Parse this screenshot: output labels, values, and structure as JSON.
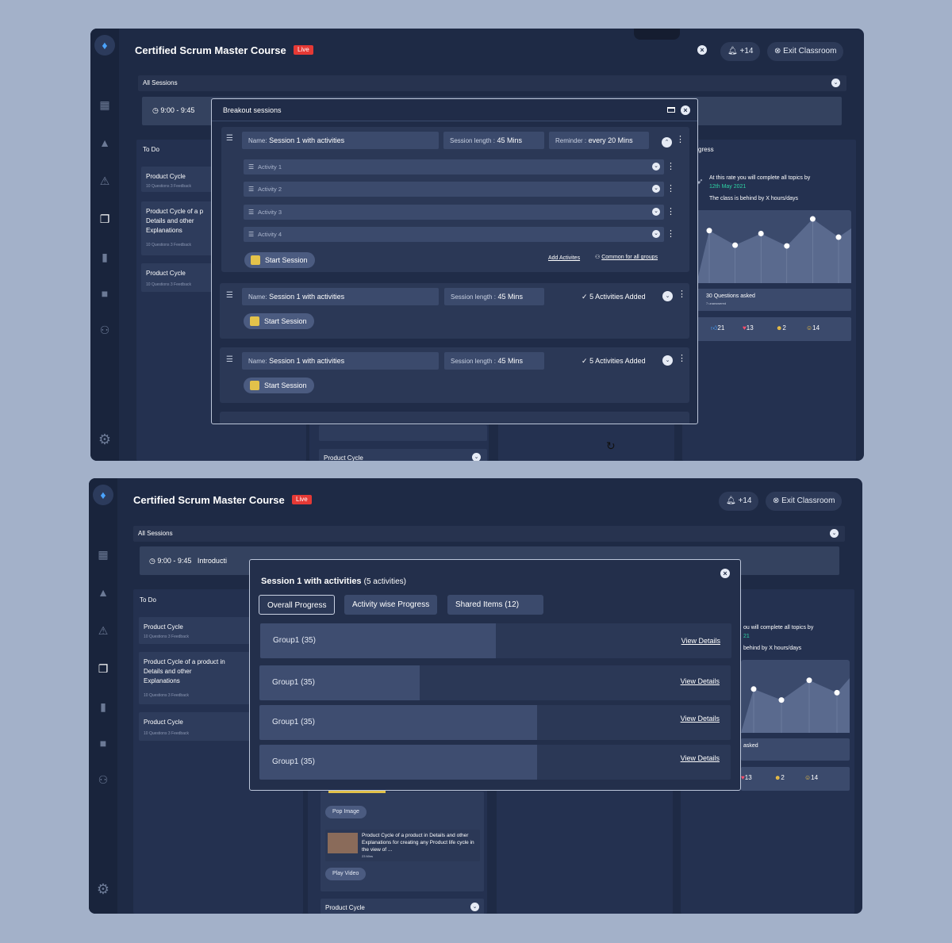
{
  "course_title": "Certified Scrum Master Course",
  "live_label": "Live",
  "notif_count": "+14",
  "exit_label": "Exit Classroom",
  "all_sessions": "All Sessions",
  "time_range": "9:00 - 9:45",
  "intro_text": "Introducti",
  "todo": "To Do",
  "progress_head": "gress",
  "todo_cards": [
    {
      "title": "Product Cycle",
      "meta": "10 Questions    3 Feedback"
    },
    {
      "title": "Product Cycle of a p",
      "title2": "Details and other",
      "title3": "Explanations",
      "meta": "10 Questions    3 Feedback"
    },
    {
      "title": "Product Cycle",
      "meta": "10 Questions    3 Feedback"
    }
  ],
  "todo_cards2": [
    {
      "title": "Product Cycle",
      "meta": "10 Questions    3 Feedback"
    },
    {
      "title": "Product Cycle of a product  in",
      "title2": "Details and other",
      "title3": "Explanations",
      "meta": "10 Questions    3 Feedback"
    },
    {
      "title": "Product Cycle",
      "meta": "10 Questions    3 Feedback"
    }
  ],
  "rate_text": "At this rate you will complete all topics by",
  "rate_date": "12th May 2021",
  "behind_text": "The class is behind by X hours/days",
  "rate_text2": "ou will complete all topics by",
  "rate_date2": "21",
  "behind_text2": "behind by X hours/days",
  "questions": "30 Questions asked",
  "unanswered": "7 unanswered",
  "questions2": "asked",
  "reactions": [
    {
      "icon": "thumbs-up",
      "count": "21"
    },
    {
      "icon": "heart",
      "count": "13"
    },
    {
      "icon": "laugh",
      "count": "2"
    },
    {
      "icon": "wow",
      "count": "14"
    }
  ],
  "chart_data": {
    "type": "line",
    "values": [
      72,
      52,
      68,
      51,
      88,
      63
    ]
  },
  "chart_data2": {
    "type": "line",
    "values": [
      60,
      45,
      72,
      55
    ]
  },
  "breakout": {
    "title": "Breakout sessions",
    "name_label": "Name:",
    "session_name": "Session 1 with activities",
    "length_label": "Session length :",
    "length_value": "45 Mins",
    "reminder_label": "Reminder :",
    "reminder_value": "every 20 Mins",
    "activities": [
      "Activity 1",
      "Activity 2",
      "Activity 3",
      "Activity 4"
    ],
    "start_label": "Start Session",
    "add_activities": "Add Activites",
    "common_groups": "Common for all groups",
    "added_label": "5 Activities Added"
  },
  "bottom_card": "Product Cycle",
  "progress_modal": {
    "title": "Session 1 with activities",
    "count": "(5 activities)",
    "tabs": [
      "Overall  Progress",
      "Activity wise Progress",
      "Shared Items (12)"
    ],
    "groups": [
      {
        "label": "Group1 (35)",
        "link": "View Details",
        "fill": 0.5
      },
      {
        "label": "Group1 (35)",
        "link": "View Details",
        "fill": 0.34
      },
      {
        "label": "Group1 (35)",
        "link": "View Details",
        "fill": 0.59
      },
      {
        "label": "Group1 (35)",
        "link": "View Details",
        "fill": 0.59
      }
    ]
  },
  "pop_image": "Pop Image",
  "video_desc": "Product Cycle of a product in Details and other Explanations for creating any Product life cycle in the view of ...",
  "video_len": "23 Mins",
  "play_video": "Play Video"
}
